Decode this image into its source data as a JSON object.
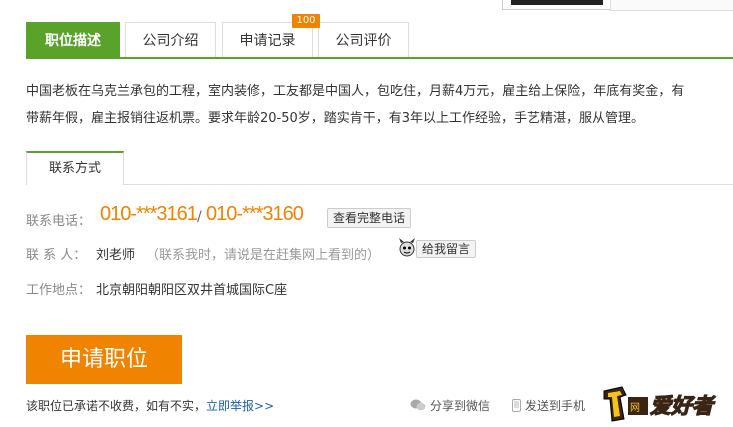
{
  "tabs": [
    {
      "label": "职位描述",
      "active": true
    },
    {
      "label": "公司介绍"
    },
    {
      "label": "申请记录",
      "badge": "100"
    },
    {
      "label": "公司评价"
    }
  ],
  "description": {
    "line1": "中国老板在乌克兰承包的工程，室内装修，工友都是中国人，包吃住，月薪4万元，雇主给上保险，年底有奖金，有",
    "line2": "带薪年假，雇主报销往返机票。要求年龄20-50岁，踏实肯干，有3年以上工作经验，手艺精湛，服从管理。"
  },
  "contact_tab": "联系方式",
  "contact": {
    "phone_label": "联系电话：",
    "phone1": "010-***3161",
    "phone2": "010-***3160",
    "view_full_phone": "查看完整电话",
    "person_label": "联 系 人：",
    "person_name": "刘老师",
    "person_hint": "（联系我时，请说是在赶集网上看到的）",
    "message_button": "给我留言",
    "address_label": "工作地点：",
    "address": "北京朝阳朝阳区双井首城国际C座"
  },
  "apply_button": "申请职位",
  "footer": {
    "note": "该职位已承诺不收费，如有不实，",
    "report_link": "立即举报>>",
    "share_wechat": "分享到微信",
    "send_phone": "发送到手机"
  },
  "logo_text": "爱好者",
  "colors": {
    "green": "#59a32b",
    "orange": "#f08300",
    "link": "#1a5fb4"
  }
}
